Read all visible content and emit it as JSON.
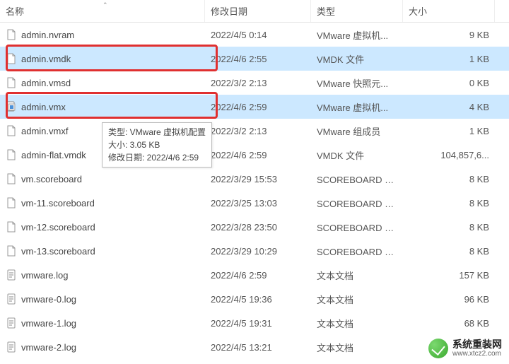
{
  "columns": {
    "name": "名称",
    "date": "修改日期",
    "type": "类型",
    "size": "大小"
  },
  "files": [
    {
      "name": "admin.nvram",
      "date": "2022/4/5 0:14",
      "type": "VMware 虚拟机...",
      "size": "9 KB",
      "icon": "doc",
      "selected": false
    },
    {
      "name": "admin.vmdk",
      "date": "2022/4/6 2:55",
      "type": "VMDK 文件",
      "size": "1 KB",
      "icon": "doc",
      "selected": true
    },
    {
      "name": "admin.vmsd",
      "date": "2022/3/2 2:13",
      "type": "VMware 快照元...",
      "size": "0 KB",
      "icon": "doc",
      "selected": false
    },
    {
      "name": "admin.vmx",
      "date": "2022/4/6 2:59",
      "type": "VMware 虚拟机...",
      "size": "4 KB",
      "icon": "vmx",
      "selected": true
    },
    {
      "name": "admin.vmxf",
      "date": "2022/3/2 2:13",
      "type": "VMware 组成员",
      "size": "1 KB",
      "icon": "doc",
      "selected": false
    },
    {
      "name": "admin-flat.vmdk",
      "date": "2022/4/6 2:59",
      "type": "VMDK 文件",
      "size": "104,857,6...",
      "icon": "doc",
      "selected": false
    },
    {
      "name": "vm.scoreboard",
      "date": "2022/3/29 15:53",
      "type": "SCOREBOARD 文...",
      "size": "8 KB",
      "icon": "doc",
      "selected": false
    },
    {
      "name": "vm-11.scoreboard",
      "date": "2022/3/25 13:03",
      "type": "SCOREBOARD 文...",
      "size": "8 KB",
      "icon": "doc",
      "selected": false
    },
    {
      "name": "vm-12.scoreboard",
      "date": "2022/3/28 23:50",
      "type": "SCOREBOARD 文...",
      "size": "8 KB",
      "icon": "doc",
      "selected": false
    },
    {
      "name": "vm-13.scoreboard",
      "date": "2022/3/29 10:29",
      "type": "SCOREBOARD 文...",
      "size": "8 KB",
      "icon": "doc",
      "selected": false
    },
    {
      "name": "vmware.log",
      "date": "2022/4/6 2:59",
      "type": "文本文档",
      "size": "157 KB",
      "icon": "txt",
      "selected": false
    },
    {
      "name": "vmware-0.log",
      "date": "2022/4/5 19:36",
      "type": "文本文档",
      "size": "96 KB",
      "icon": "txt",
      "selected": false
    },
    {
      "name": "vmware-1.log",
      "date": "2022/4/5 19:31",
      "type": "文本文档",
      "size": "68 KB",
      "icon": "txt",
      "selected": false
    },
    {
      "name": "vmware-2.log",
      "date": "2022/4/5 13:21",
      "type": "文本文档",
      "size": "",
      "icon": "txt",
      "selected": false
    }
  ],
  "tooltip": {
    "line1": "类型: VMware 虚拟机配置",
    "line2": "大小: 3.05 KB",
    "line3": "修改日期: 2022/4/6 2:59"
  },
  "watermark": {
    "title": "系统重装网",
    "sub": "www.xtcz2.com"
  }
}
